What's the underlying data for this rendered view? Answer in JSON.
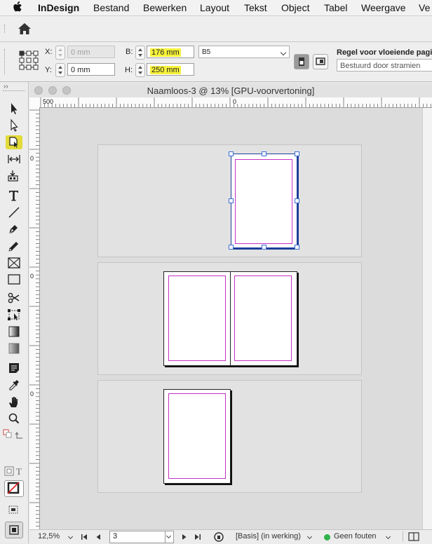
{
  "menubar": {
    "app_name": "InDesign",
    "items": [
      "Bestand",
      "Bewerken",
      "Layout",
      "Tekst",
      "Object",
      "Tabel",
      "Weergave",
      "Ve"
    ]
  },
  "control": {
    "x_label": "X:",
    "x_value": "0 mm",
    "y_label": "Y:",
    "y_value": "0 mm",
    "w_label": "B:",
    "w_value": "176 mm",
    "h_label": "H:",
    "h_value": "250 mm",
    "page_size": "B5",
    "liquid_rule_label": "Regel voor vloeiende pagina",
    "liquid_rule_value": "Bestuurd door stramien"
  },
  "document": {
    "title": "Naamloos-3 @ 13% [GPU-voorvertoning]",
    "ruler_h": [
      "500",
      "0"
    ],
    "ruler_v": [
      "0",
      "0",
      "0"
    ]
  },
  "statusbar": {
    "zoom": "12,5%",
    "page_number": "3",
    "master": "[Basis] (in werking)",
    "preflight": "Geen fouten"
  },
  "colors": {
    "highlight": "#f6f23a",
    "margin_guides": "#c531c5",
    "selection": "#3a6fd8",
    "preflight_ok": "#2fb34a"
  }
}
